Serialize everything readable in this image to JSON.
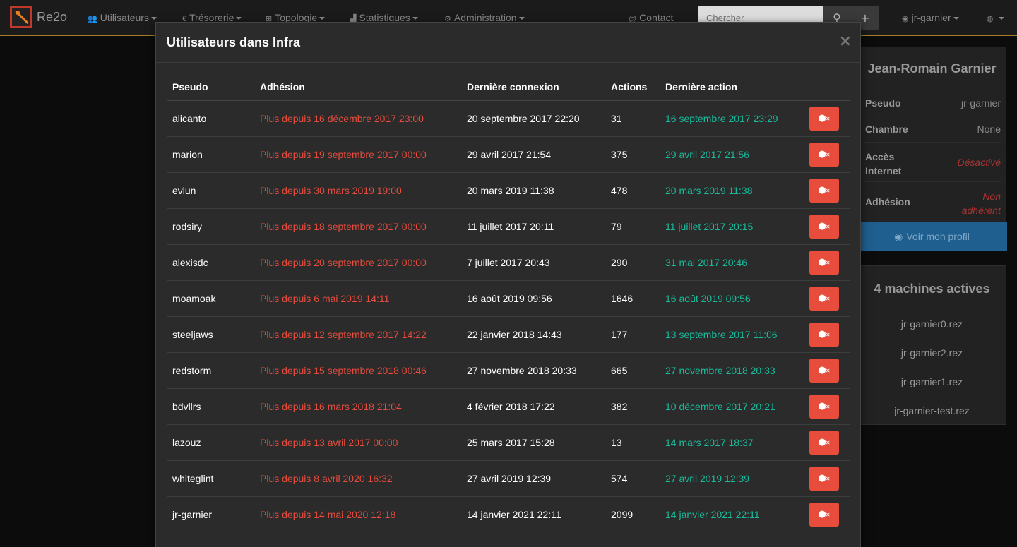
{
  "brand": {
    "name": "Re2o"
  },
  "nav": {
    "users": "Utilisateurs",
    "treasury": "Trésorerie",
    "topology": "Topologie",
    "stats": "Statistiques",
    "admin": "Administration",
    "contact": "Contact",
    "search_placeholder": "Chercher",
    "user": "jr-garnier"
  },
  "modal": {
    "title": "Utilisateurs dans Infra",
    "close": "×",
    "columns": [
      "Pseudo",
      "Adhésion",
      "Dernière connexion",
      "Actions",
      "Dernière action"
    ],
    "rows": [
      {
        "pseudo": "alicanto",
        "adhesion": "Plus depuis 16 décembre 2017 23:00",
        "last_login": "20 septembre 2017 22:20",
        "actions": "31",
        "last_action": "16 septembre 2017 23:29"
      },
      {
        "pseudo": "marion",
        "adhesion": "Plus depuis 19 septembre 2017 00:00",
        "last_login": "29 avril 2017 21:54",
        "actions": "375",
        "last_action": "29 avril 2017 21:56"
      },
      {
        "pseudo": "evlun",
        "adhesion": "Plus depuis 30 mars 2019 19:00",
        "last_login": "20 mars 2019 11:38",
        "actions": "478",
        "last_action": "20 mars 2019 11:38"
      },
      {
        "pseudo": "rodsiry",
        "adhesion": "Plus depuis 18 septembre 2017 00:00",
        "last_login": "11 juillet 2017 20:11",
        "actions": "79",
        "last_action": "11 juillet 2017 20:15"
      },
      {
        "pseudo": "alexisdc",
        "adhesion": "Plus depuis 20 septembre 2017 00:00",
        "last_login": "7 juillet 2017 20:43",
        "actions": "290",
        "last_action": "31 mai 2017 20:46"
      },
      {
        "pseudo": "moamoak",
        "adhesion": "Plus depuis 6 mai 2019 14:11",
        "last_login": "16 août 2019 09:56",
        "actions": "1646",
        "last_action": "16 août 2019 09:56"
      },
      {
        "pseudo": "steeljaws",
        "adhesion": "Plus depuis 12 septembre 2017 14:22",
        "last_login": "22 janvier 2018 14:43",
        "actions": "177",
        "last_action": "13 septembre 2017 11:06"
      },
      {
        "pseudo": "redstorm",
        "adhesion": "Plus depuis 15 septembre 2018 00:46",
        "last_login": "27 novembre 2018 20:33",
        "actions": "665",
        "last_action": "27 novembre 2018 20:33"
      },
      {
        "pseudo": "bdvllrs",
        "adhesion": "Plus depuis 16 mars 2018 21:04",
        "last_login": "4 février 2018 17:22",
        "actions": "382",
        "last_action": "10 décembre 2017 20:21"
      },
      {
        "pseudo": "lazouz",
        "adhesion": "Plus depuis 13 avril 2017 00:00",
        "last_login": "25 mars 2017 15:28",
        "actions": "13",
        "last_action": "14 mars 2017 18:37"
      },
      {
        "pseudo": "whiteglint",
        "adhesion": "Plus depuis 8 avril 2020 16:32",
        "last_login": "27 avril 2019 12:39",
        "actions": "574",
        "last_action": "27 avril 2019 12:39"
      },
      {
        "pseudo": "jr-garnier",
        "adhesion": "Plus depuis 14 mai 2020 12:18",
        "last_login": "14 janvier 2021 22:11",
        "actions": "2099",
        "last_action": "14 janvier 2021 22:11"
      }
    ]
  },
  "profile": {
    "name": "Jean-Romain Garnier",
    "pseudo_label": "Pseudo",
    "pseudo_value": "jr-garnier",
    "room_label": "Chambre",
    "room_value": "None",
    "internet_label": "Accès Internet",
    "internet_value": "Désactivé",
    "membership_label": "Adhésion",
    "membership_value": "Non adhérent",
    "profile_button": "Voir mon profil"
  },
  "machines": {
    "title": "4 machines actives",
    "items": [
      "jr-garnier0.rez",
      "jr-garnier2.rez",
      "jr-garnier1.rez",
      "jr-garnier-test.rez"
    ]
  }
}
